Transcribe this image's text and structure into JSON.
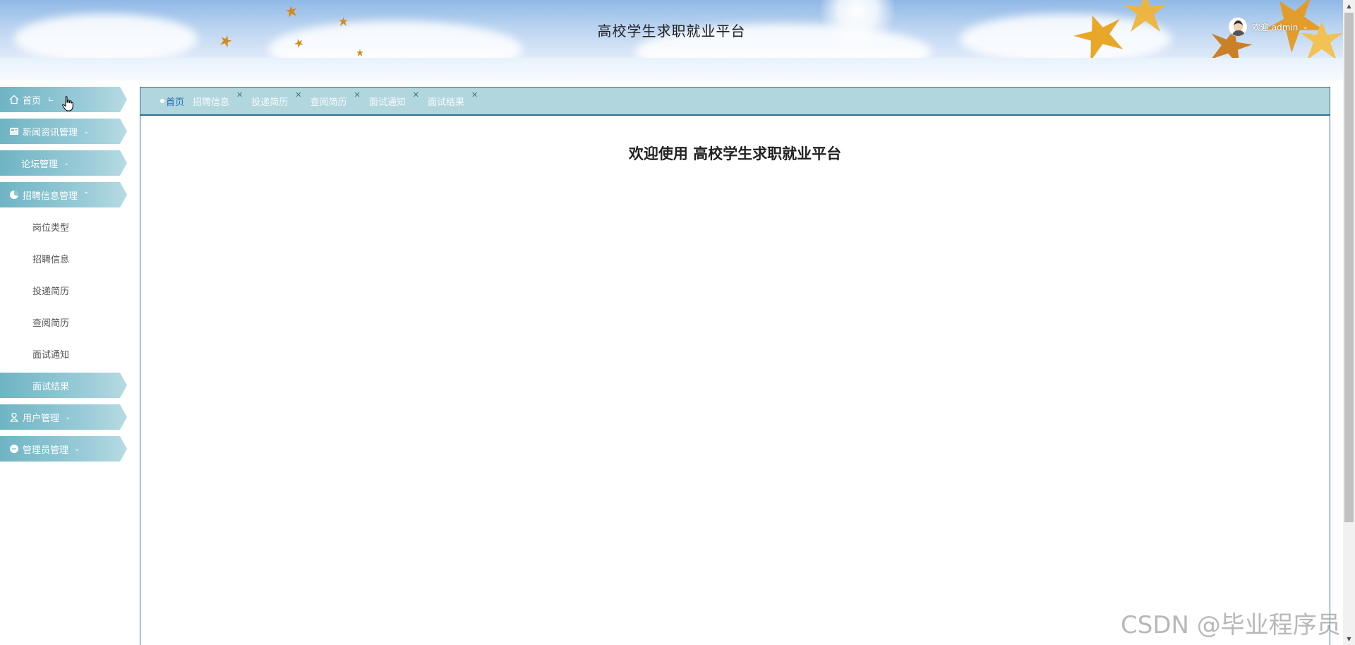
{
  "header": {
    "title": "高校学生求职就业平台",
    "user_label": "欢迎 admin"
  },
  "sidebar": {
    "items": [
      {
        "label": "首页",
        "icon": "home-icon"
      },
      {
        "label": "新闻资讯管理",
        "icon": "news-icon"
      },
      {
        "label": "论坛管理",
        "icon": ""
      },
      {
        "label": "招聘信息管理",
        "icon": "pie-chart-icon"
      },
      {
        "label": "用户管理",
        "icon": "user-icon"
      },
      {
        "label": "管理员管理",
        "icon": "admin-icon"
      }
    ],
    "home_mark": "∟",
    "sub_items": [
      {
        "label": "岗位类型"
      },
      {
        "label": "招聘信息"
      },
      {
        "label": "投递简历"
      },
      {
        "label": "查阅简历"
      },
      {
        "label": "面试通知"
      },
      {
        "label": "面试结果"
      }
    ]
  },
  "tabs": [
    {
      "label": "首页"
    },
    {
      "label": "招聘信息"
    },
    {
      "label": "投递简历"
    },
    {
      "label": "查阅简历"
    },
    {
      "label": "面试通知"
    },
    {
      "label": "面试结果"
    }
  ],
  "main": {
    "welcome": "欢迎使用 高校学生求职就业平台"
  },
  "watermark": "CSDN @毕业程序员",
  "colors": {
    "accent": "#2f6f8f",
    "menu": "#6fb4c4",
    "tabbar": "#b2d6de"
  }
}
